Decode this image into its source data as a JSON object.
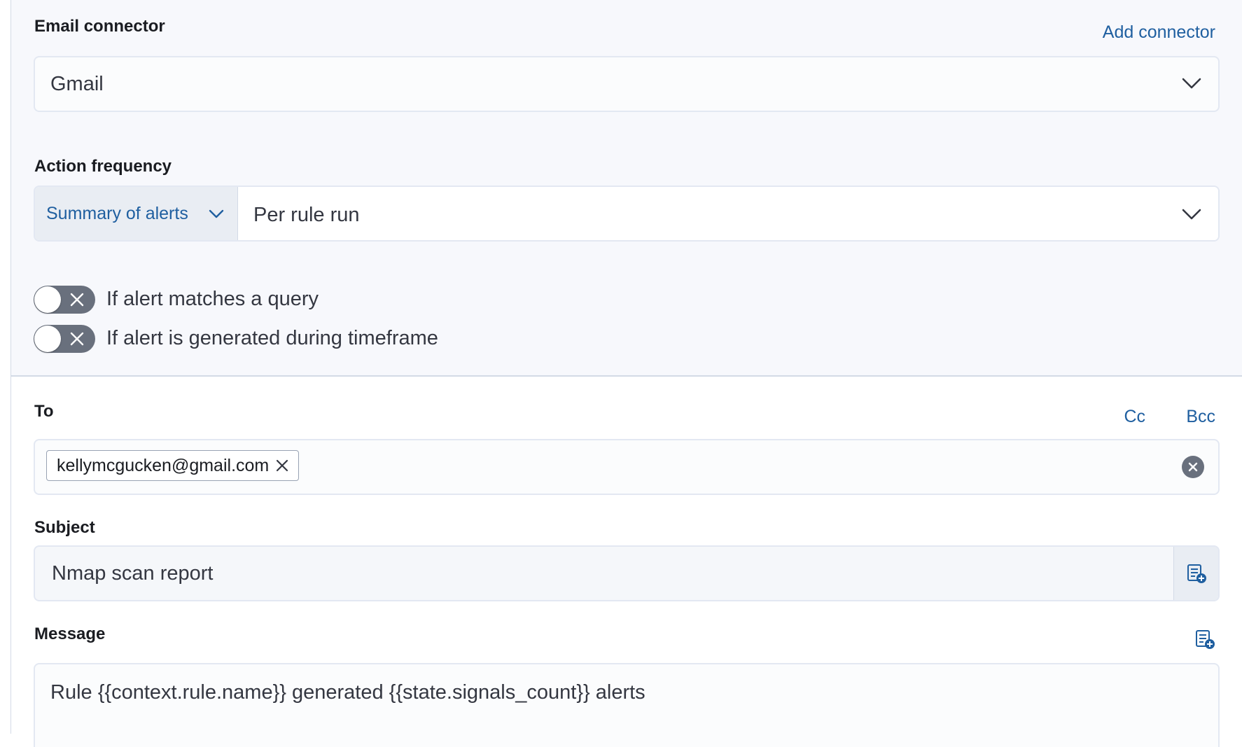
{
  "email_connector": {
    "label": "Email connector",
    "add_connector_link": "Add connector",
    "selected_value": "Gmail"
  },
  "action_frequency": {
    "label": "Action frequency",
    "mode": "Summary of alerts",
    "interval": "Per rule run"
  },
  "toggles": [
    {
      "label": "If alert matches a query",
      "checked": false
    },
    {
      "label": "If alert is generated during timeframe",
      "checked": false
    }
  ],
  "to": {
    "label": "To",
    "cc_link": "Cc",
    "bcc_link": "Bcc",
    "recipients": [
      "kellymcgucken@gmail.com"
    ]
  },
  "subject": {
    "label": "Subject",
    "value": "Nmap scan report"
  },
  "message": {
    "label": "Message",
    "value": "Rule {{context.rule.name}} generated {{state.signals_count}} alerts"
  },
  "colors": {
    "accent": "#1f5fa0",
    "panel_background": "#f7f8fc",
    "toggle_off": "#69707d"
  }
}
